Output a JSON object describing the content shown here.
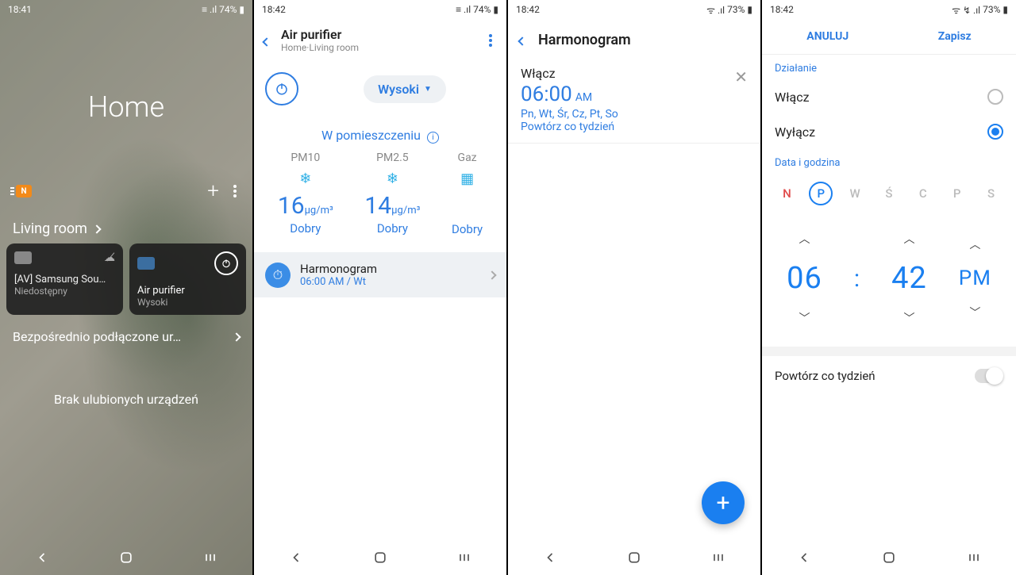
{
  "s1": {
    "status_time": "18:41",
    "battery": "74%",
    "title": "Home",
    "room": "Living room",
    "cards": [
      {
        "name": "[AV] Samsung Sou…",
        "sub": "Niedostępny"
      },
      {
        "name": "Air purifier",
        "sub": "Wysoki"
      }
    ],
    "connected_label": "Bezpośrednio podłączone ur…",
    "favorites_empty": "Brak ulubionych urządzeń"
  },
  "s2": {
    "status_time": "18:42",
    "battery": "74%",
    "title": "Air purifier",
    "subtitle": "Home·Living room",
    "mode_label": "Wysoki",
    "indoor_label": "W pomieszczeniu",
    "metrics": [
      {
        "label": "PM10",
        "value": "16",
        "unit": "µg/m³",
        "quality": "Dobry"
      },
      {
        "label": "PM2.5",
        "value": "14",
        "unit": "µg/m³",
        "quality": "Dobry"
      },
      {
        "label": "Gaz",
        "value": "",
        "unit": "",
        "quality": "Dobry"
      }
    ],
    "schedule_title": "Harmonogram",
    "schedule_sub": "06:00 AM / Wt"
  },
  "s3": {
    "status_time": "18:42",
    "battery": "73%",
    "title": "Harmonogram",
    "entry": {
      "action": "Włącz",
      "time": "06:00",
      "ampm": "AM",
      "days": "Pn, Wt, Śr, Cz, Pt, So",
      "repeat": "Powtórz co tydzień"
    }
  },
  "s4": {
    "status_time": "18:42",
    "battery": "73%",
    "cancel": "ANULUJ",
    "save": "Zapisz",
    "action_label": "Działanie",
    "opt_on": "Włącz",
    "opt_off": "Wyłącz",
    "datetime_label": "Data i godzina",
    "days": [
      "N",
      "P",
      "W",
      "Ś",
      "C",
      "P",
      "S"
    ],
    "selected_day_index": 1,
    "hour": "06",
    "minute": "42",
    "ampm": "PM",
    "repeat_label": "Powtórz co tydzień"
  }
}
